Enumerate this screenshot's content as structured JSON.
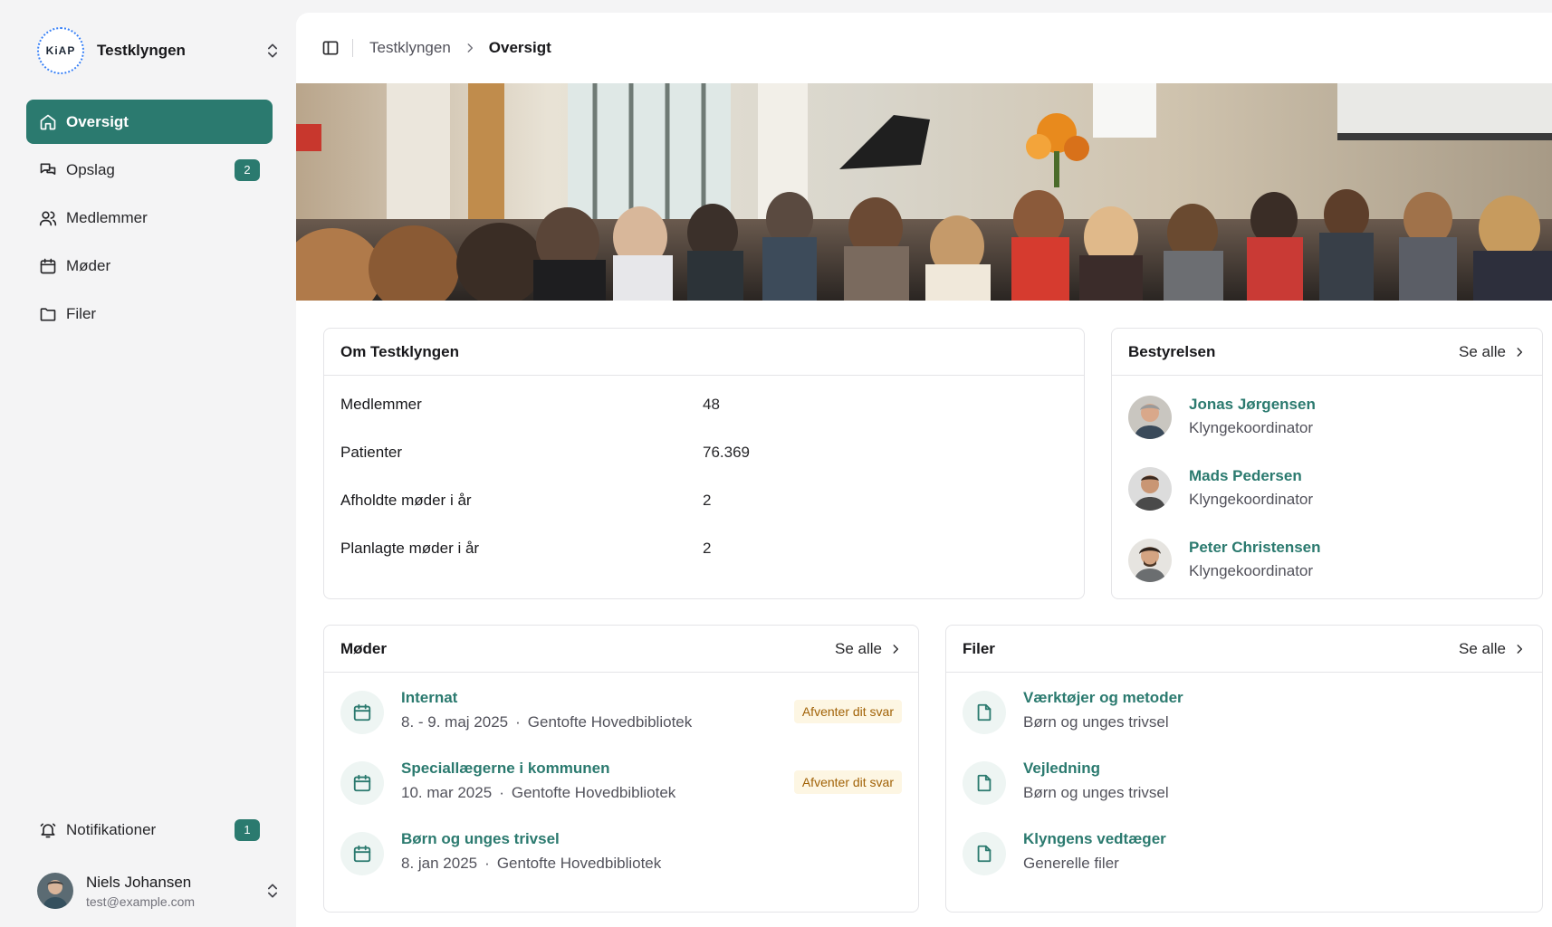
{
  "sidebar": {
    "org": {
      "logo_text": "KiAP",
      "name": "Testklyngen"
    },
    "nav": [
      {
        "label": "Oversigt",
        "icon": "home-icon",
        "active": true
      },
      {
        "label": "Opslag",
        "icon": "chat-icon",
        "badge": "2"
      },
      {
        "label": "Medlemmer",
        "icon": "users-icon"
      },
      {
        "label": "Møder",
        "icon": "calendar-icon"
      },
      {
        "label": "Filer",
        "icon": "folder-icon"
      }
    ],
    "notifications": {
      "label": "Notifikationer",
      "badge": "1",
      "icon": "bell-icon"
    },
    "user": {
      "name": "Niels Johansen",
      "email": "test@example.com"
    }
  },
  "header": {
    "breadcrumb": [
      "Testklyngen",
      "Oversigt"
    ]
  },
  "about": {
    "title": "Om Testklyngen",
    "rows": [
      {
        "label": "Medlemmer",
        "value": "48"
      },
      {
        "label": "Patienter",
        "value": "76.369"
      },
      {
        "label": "Afholdte møder i år",
        "value": "2"
      },
      {
        "label": "Planlagte møder i år",
        "value": "2"
      }
    ]
  },
  "board": {
    "title": "Bestyrelsen",
    "see_all": "Se alle",
    "members": [
      {
        "name": "Jonas Jørgensen",
        "role": "Klyngekoordinator"
      },
      {
        "name": "Mads Pedersen",
        "role": "Klyngekoordinator"
      },
      {
        "name": "Peter Christensen",
        "role": "Klyngekoordinator"
      }
    ]
  },
  "meetings": {
    "title": "Møder",
    "see_all": "Se alle",
    "items": [
      {
        "title": "Internat",
        "date": "8. - 9. maj 2025",
        "separator": "·",
        "location": "Gentofte Hovedbibliotek",
        "status": "Afventer dit svar"
      },
      {
        "title": "Speciallægerne i kommunen",
        "date": "10. mar 2025",
        "separator": "·",
        "location": "Gentofte Hovedbibliotek",
        "status": "Afventer dit svar"
      },
      {
        "title": "Børn og unges trivsel",
        "date": "8. jan 2025",
        "separator": "·",
        "location": "Gentofte Hovedbibliotek",
        "status": ""
      }
    ]
  },
  "files": {
    "title": "Filer",
    "see_all": "Se alle",
    "items": [
      {
        "title": "Værktøjer og metoder",
        "category": "Børn og unges trivsel"
      },
      {
        "title": "Vejledning",
        "category": "Børn og unges trivsel"
      },
      {
        "title": "Klyngens vedtæger",
        "category": "Generelle filer"
      }
    ]
  },
  "colors": {
    "brand": "#2b7a6f",
    "pending_bg": "#fdf6e3",
    "pending_text": "#a16207"
  }
}
